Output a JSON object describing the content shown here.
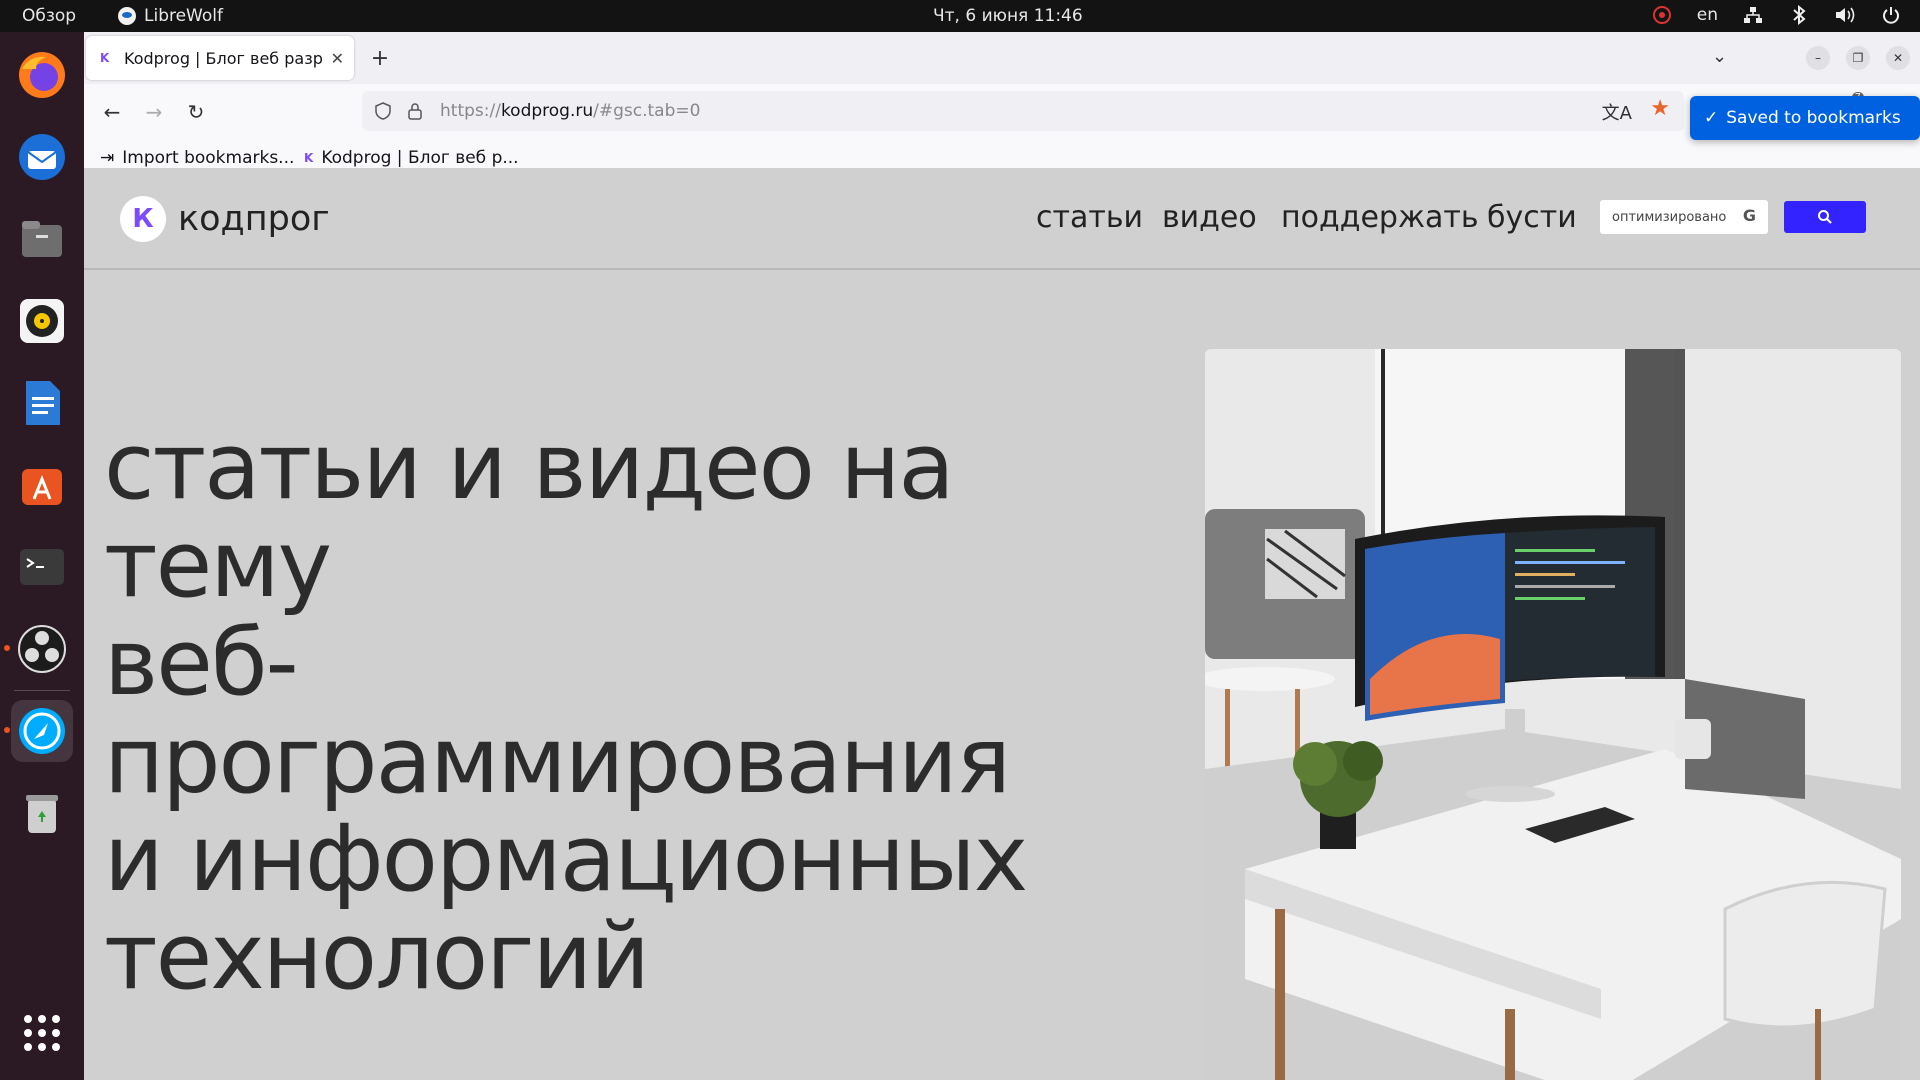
{
  "topbar": {
    "overview": "Обзор",
    "app_name": "LibreWolf",
    "clock": "Чт, 6 июня  11:46",
    "lang": "en"
  },
  "dock": {
    "items": [
      "firefox-icon",
      "thunderbird-icon",
      "files-icon",
      "rhythmbox-icon",
      "libreoffice-writer-icon",
      "app-center-icon",
      "terminal-icon",
      "obs-studio-icon",
      "librewolf-icon",
      "trash-icon"
    ],
    "apps_grid": "show-apps-icon"
  },
  "browser": {
    "tab_title": "Kodprog | Блог веб разр",
    "tab_favicon": "K",
    "url_scheme": "https://",
    "url_host": "kodprog.ru",
    "url_path": "/#gsc.tab=0",
    "extension_badge": "7",
    "bookmarks": [
      {
        "label": "Import bookmarks..."
      },
      {
        "label": "Kodprog | Блог веб р..."
      }
    ],
    "saved_popup": "Saved to bookmarks"
  },
  "site": {
    "logo_letter": "К",
    "logo_name": "кодпрог",
    "menu": [
      "статьи",
      "видео",
      "поддержать",
      "бусти"
    ],
    "search_placeholder": "оптимизировано",
    "search_g": "G",
    "hero_lines": [
      "статьи и видео на",
      "тему",
      "веб-",
      "программирования",
      "и информационных",
      "технологий"
    ]
  },
  "colors": {
    "accent_button": "#3324ff",
    "popup_blue": "#0061e0",
    "star_orange": "#e8662b",
    "page_bg": "#d0d0d0"
  }
}
